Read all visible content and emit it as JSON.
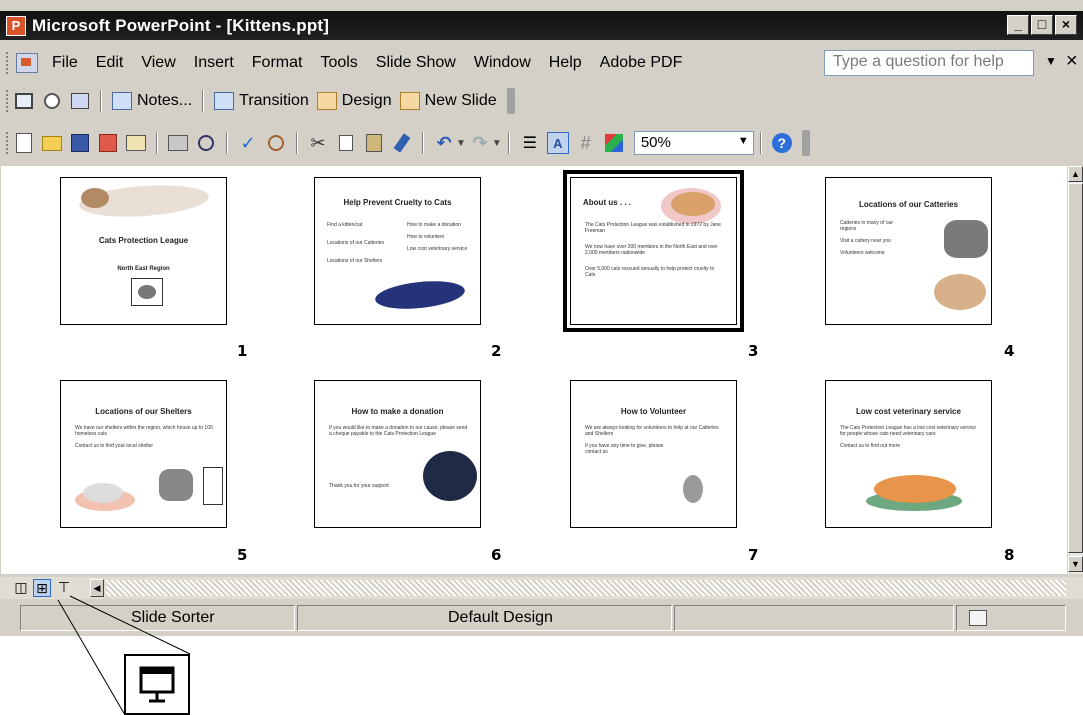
{
  "window": {
    "title": "Microsoft PowerPoint - [Kittens.ppt]",
    "controls": [
      "_",
      "□",
      "×"
    ]
  },
  "menubar": {
    "items": [
      "File",
      "Edit",
      "View",
      "Insert",
      "Format",
      "Tools",
      "Slide Show",
      "Window",
      "Help",
      "Adobe PDF"
    ],
    "help_placeholder": "Type a question for help",
    "close": "×"
  },
  "toolbar1": {
    "notes": "Notes...",
    "transition": "Transition",
    "design": "Design",
    "new_slide": "New Slide"
  },
  "toolbar2": {
    "zoom": "50%",
    "icons": [
      "new-icon",
      "open-icon",
      "save-icon",
      "permission-icon",
      "email-icon",
      "print-icon",
      "print-preview-icon",
      "spelling-icon",
      "research-icon",
      "cut-icon",
      "copy-icon",
      "paste-icon",
      "format-painter-icon",
      "undo-icon",
      "redo-icon",
      "expand-all-icon",
      "show-formatting-icon",
      "grid-icon",
      "color-icon",
      "help-icon"
    ]
  },
  "slides": [
    {
      "number": "1",
      "title": "Cats Protection League",
      "subtitle": "North East Region",
      "bullets": []
    },
    {
      "number": "2",
      "title": "Help Prevent Cruelty to Cats",
      "subtitle": "",
      "bullets": [
        "Find a kitten/cat",
        "Locations of our Catteries",
        "Locations of our Shelters",
        "How to make a donation",
        "How to volunteer",
        "Low cost veterinary service"
      ]
    },
    {
      "number": "3",
      "title": "About us . . .",
      "subtitle": "",
      "bullets": [
        "The Cats Protection League was established in 1972 by Jane Freeman",
        "We now have over 200 members in the North East and over 2,000 members nationwide",
        "Over 5,000 cats rescued annually to help protect cruelty to Cats"
      ]
    },
    {
      "number": "4",
      "title": "Locations of our Catteries",
      "subtitle": "",
      "bullets": [
        "Catteries in many of our regions",
        "Visit a cattery near you",
        "Volunteers welcome"
      ]
    },
    {
      "number": "5",
      "title": "Locations of our Shelters",
      "subtitle": "",
      "bullets": [
        "We have our shelters within the region, which house up to 100 homeless cats",
        "Contact us to find your local shelter"
      ]
    },
    {
      "number": "6",
      "title": "How to make a donation",
      "subtitle": "",
      "bullets": [
        "If you would like to make a donation to our cause, please send a cheque payable to the Cats Protection League",
        "Thank you for your support"
      ]
    },
    {
      "number": "7",
      "title": "How to Volunteer",
      "subtitle": "",
      "bullets": [
        "We are always looking for volunteers to help at our Catteries and Shelters",
        "If you have any time to give, please contact us"
      ]
    },
    {
      "number": "8",
      "title": "Low cost veterinary service",
      "subtitle": "",
      "bullets": [
        "The Cats Protection League has a low cost veterinary service for people whose cats need veterinary care",
        "Contact us to find out more"
      ]
    }
  ],
  "statusbar": {
    "view": "Slide Sorter",
    "design": "Default Design"
  }
}
